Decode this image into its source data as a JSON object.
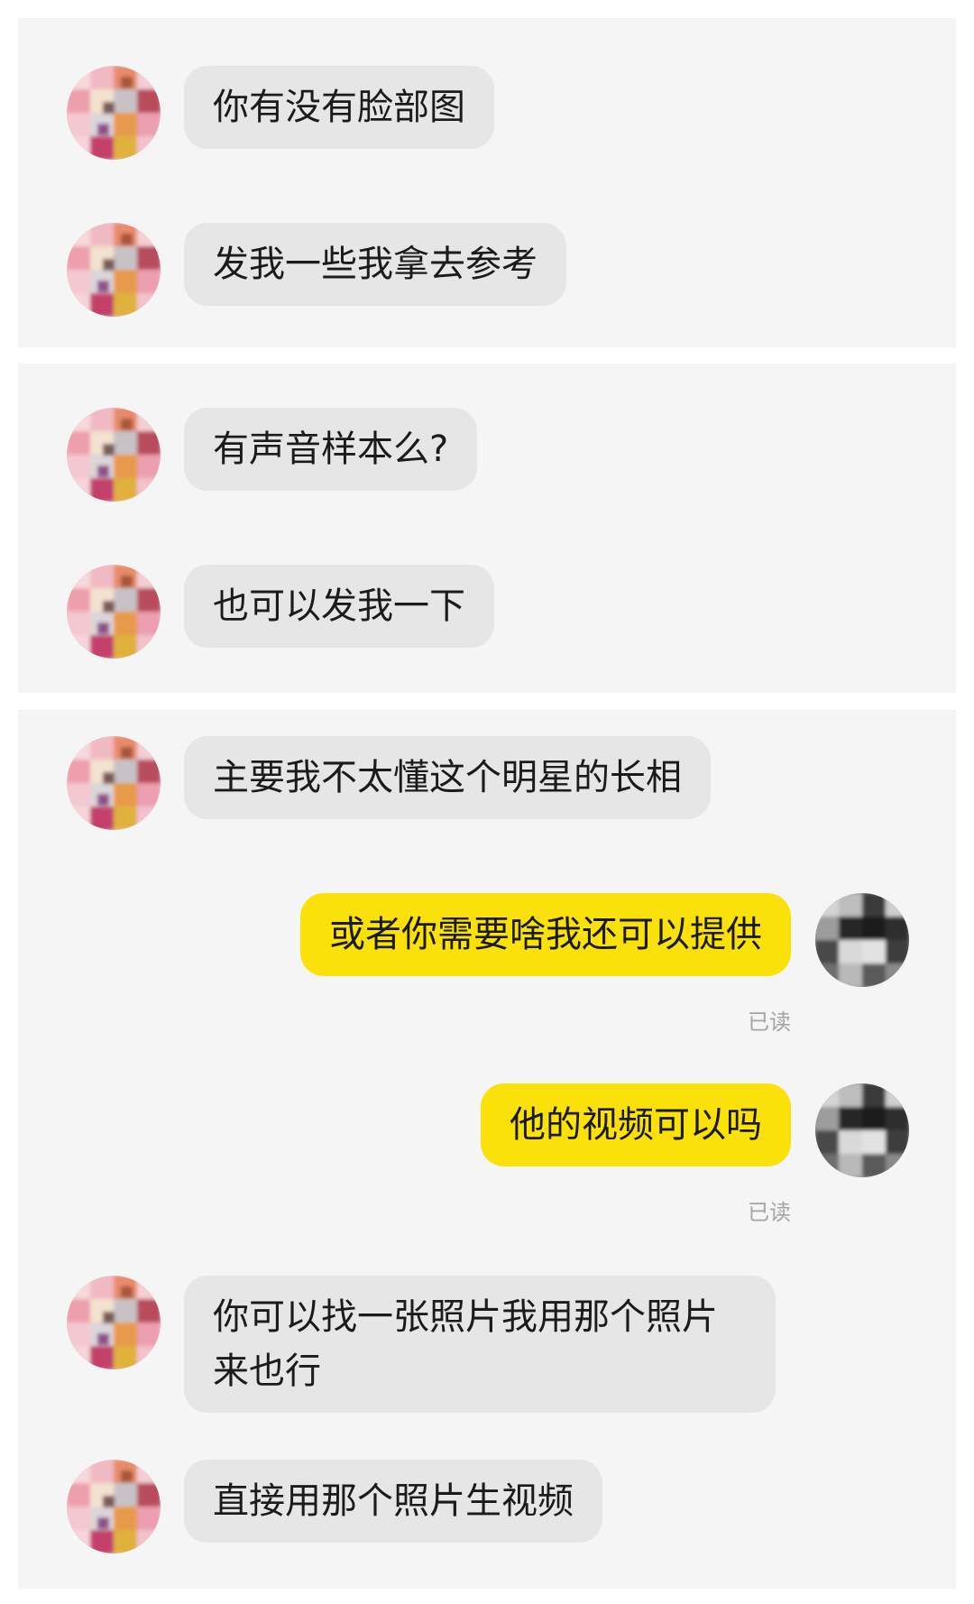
{
  "colors": {
    "panel_bg": "#f5f5f5",
    "incoming_bubble": "#e6e6e6",
    "outgoing_bubble": "#fae10a",
    "read_status_text": "#a4a4a4"
  },
  "avatars": {
    "contact": "pixelated-cartoon-avatar",
    "self": "pixelated-photo-avatar"
  },
  "panels": [
    {
      "messages": [
        {
          "side": "left",
          "text": "你有没有脸部图"
        },
        {
          "side": "left",
          "text": "发我一些我拿去参考"
        }
      ]
    },
    {
      "messages": [
        {
          "side": "left",
          "text": "有声音样本么?"
        },
        {
          "side": "left",
          "text": "也可以发我一下"
        }
      ]
    },
    {
      "messages": [
        {
          "side": "left",
          "text": "主要我不太懂这个明星的长相"
        },
        {
          "side": "right",
          "text": "或者你需要啥我还可以提供",
          "status": "已读"
        },
        {
          "side": "right",
          "text": "他的视频可以吗",
          "status": "已读"
        },
        {
          "side": "left",
          "text": "你可以找一张照片我用那个照片来也行"
        },
        {
          "side": "left",
          "text": "直接用那个照片生视频"
        }
      ]
    }
  ]
}
